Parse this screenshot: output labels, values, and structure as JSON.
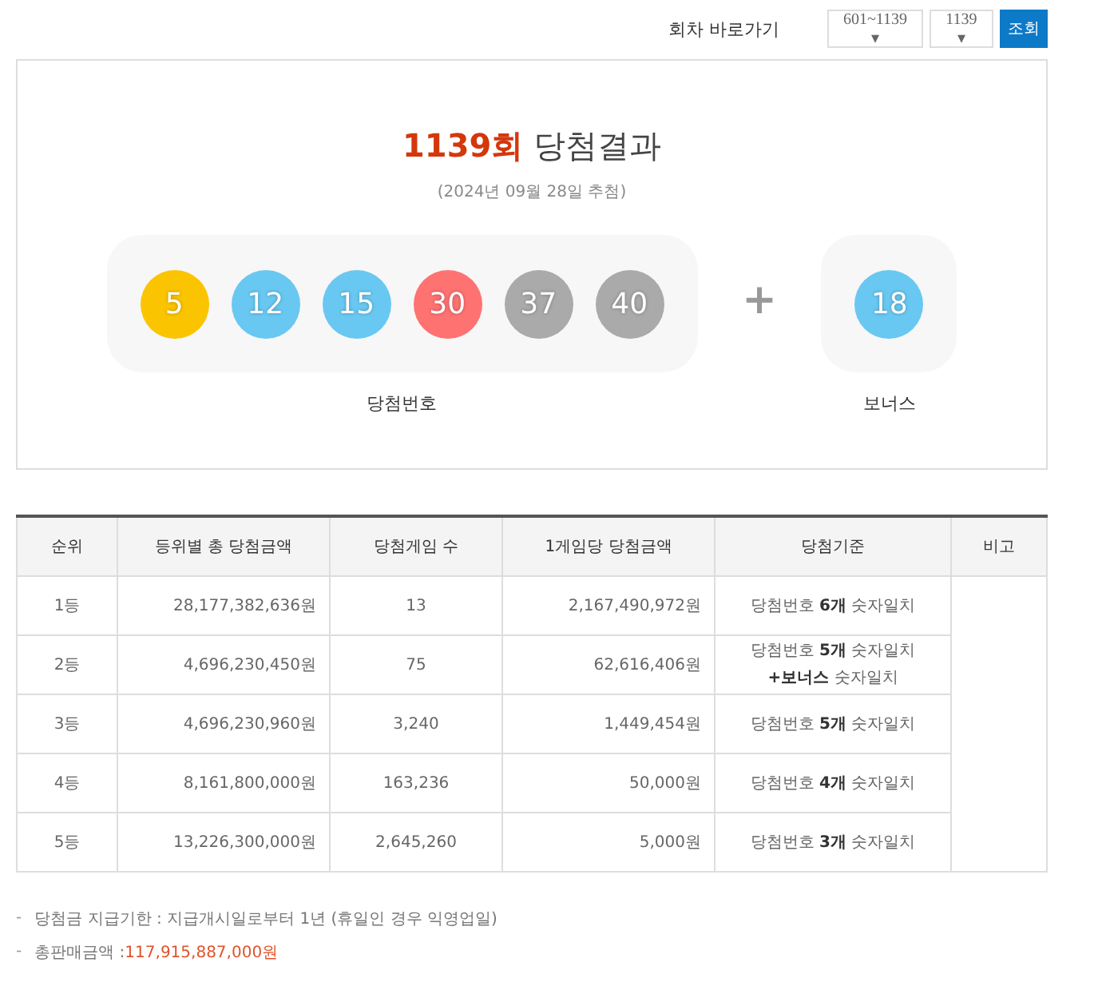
{
  "top_bar": {
    "label": "회차 바로가기",
    "range_select": "601~1139",
    "round_select": "1139",
    "caret": "▾",
    "search_button": "조회"
  },
  "result": {
    "round": "1139회",
    "title": "당첨결과",
    "date": "(2024년 09월 28일 추첨)",
    "numbers": [
      {
        "value": "5",
        "color": "#fbc400"
      },
      {
        "value": "12",
        "color": "#69c8f2"
      },
      {
        "value": "15",
        "color": "#69c8f2"
      },
      {
        "value": "30",
        "color": "#ff7272"
      },
      {
        "value": "37",
        "color": "#aaaaaa"
      },
      {
        "value": "40",
        "color": "#aaaaaa"
      }
    ],
    "plus": "+",
    "bonus": {
      "value": "18",
      "color": "#69c8f2"
    },
    "numbers_label": "당첨번호",
    "bonus_label": "보너스"
  },
  "table": {
    "columns": [
      "순위",
      "등위별 총 당첨금액",
      "당첨게임 수",
      "1게임당 당첨금액",
      "당첨기준",
      "비고"
    ],
    "rows": [
      {
        "rank": "1등",
        "total": "28,177,382,636원",
        "games": "13",
        "per_game": "2,167,490,972원",
        "criteria": [
          "당첨번호 **6개** 숫자일치"
        ]
      },
      {
        "rank": "2등",
        "total": "4,696,230,450원",
        "games": "75",
        "per_game": "62,616,406원",
        "criteria": [
          "당첨번호 **5개** 숫자일치",
          "**+보너스** 숫자일치"
        ]
      },
      {
        "rank": "3등",
        "total": "4,696,230,960원",
        "games": "3,240",
        "per_game": "1,449,454원",
        "criteria": [
          "당첨번호 **5개** 숫자일치"
        ]
      },
      {
        "rank": "4등",
        "total": "8,161,800,000원",
        "games": "163,236",
        "per_game": "50,000원",
        "criteria": [
          "당첨번호 **4개** 숫자일치"
        ]
      },
      {
        "rank": "5등",
        "total": "13,226,300,000원",
        "games": "2,645,260",
        "per_game": "5,000원",
        "criteria": [
          "당첨번호 **3개** 숫자일치"
        ]
      }
    ]
  },
  "notes": [
    {
      "marker": "-",
      "label": "당첨금 지급기한 : 지급개시일로부터 1년 (휴일인 경우 익영업일)"
    },
    {
      "marker": "-",
      "label": "총판매금액 : ",
      "value": "117,915,887,000원"
    }
  ]
}
